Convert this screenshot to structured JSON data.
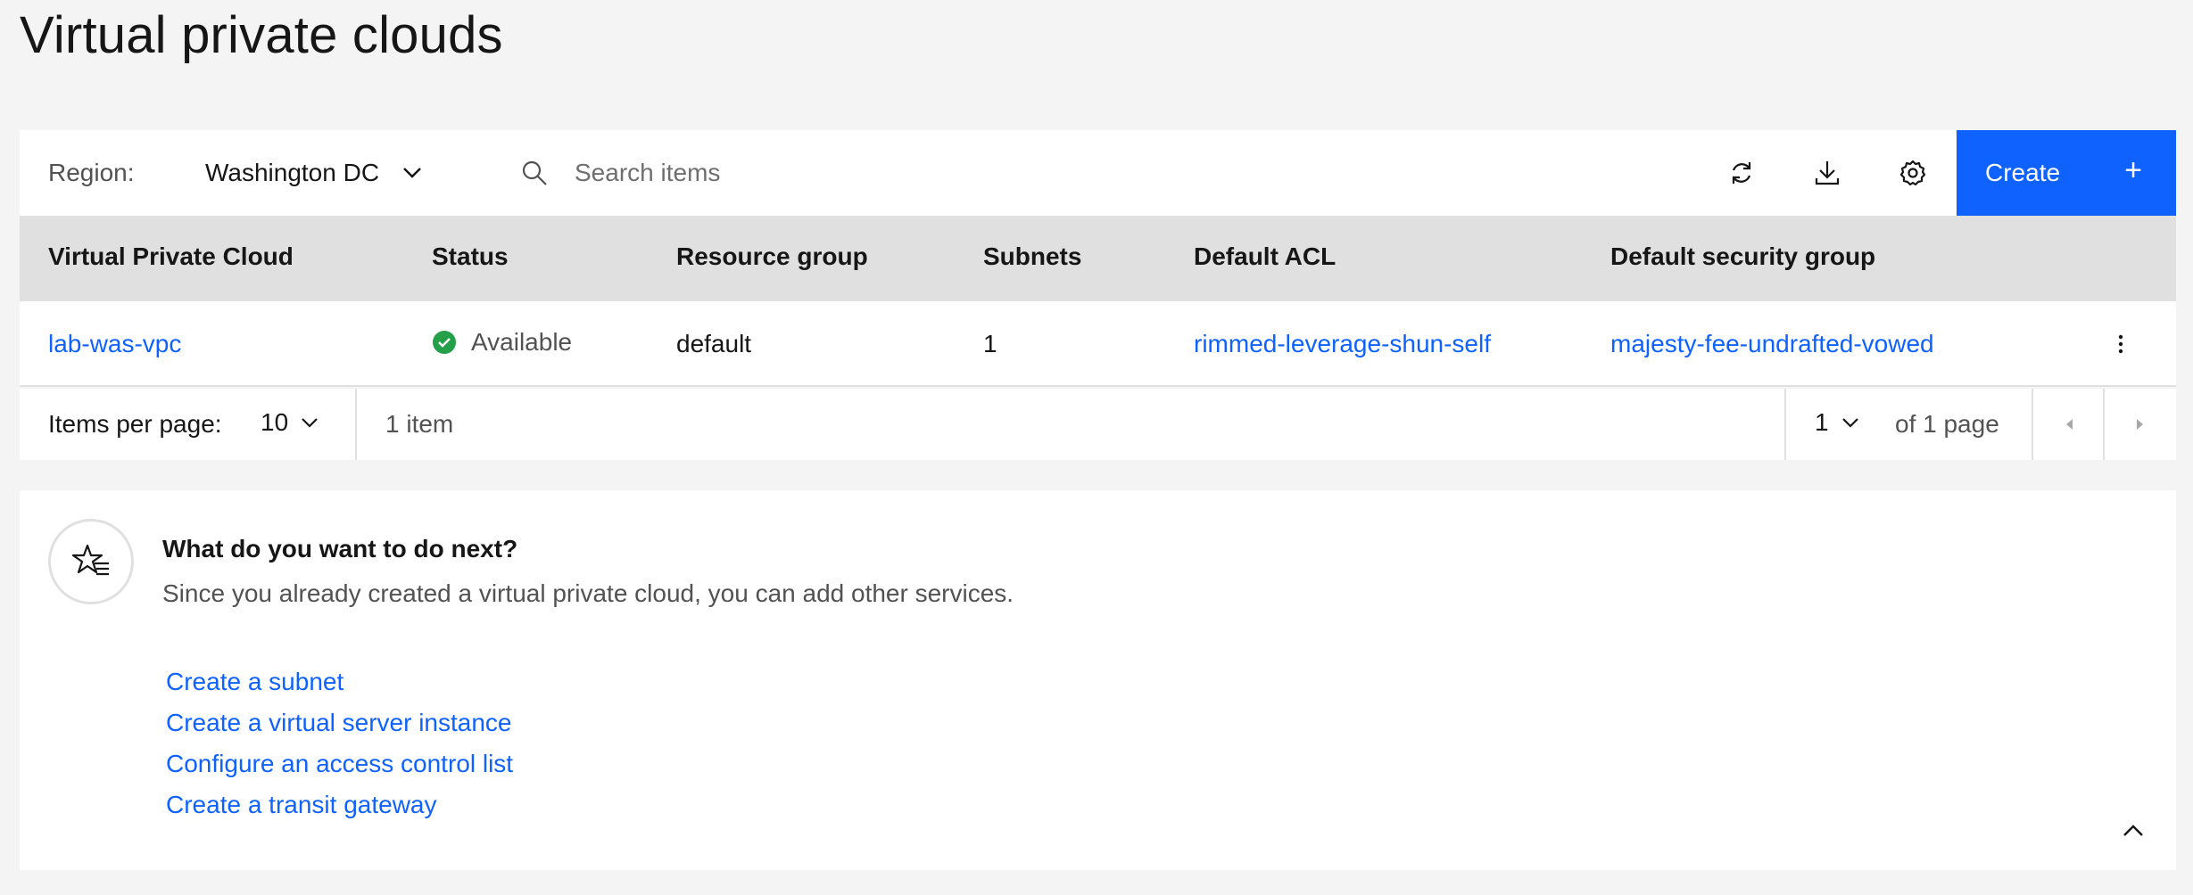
{
  "page": {
    "title": "Virtual private clouds"
  },
  "toolbar": {
    "region_label": "Region:",
    "region_value": "Washington DC",
    "search_placeholder": "Search items",
    "create_label": "Create",
    "create_icon": "+"
  },
  "table": {
    "headers": [
      "Virtual Private Cloud",
      "Status",
      "Resource group",
      "Subnets",
      "Default ACL",
      "Default security group"
    ],
    "rows": [
      {
        "name": "lab-was-vpc",
        "status": "Available",
        "resource_group": "default",
        "subnets": "1",
        "default_acl": "rimmed-leverage-shun-self",
        "default_security_group": "majesty-fee-undrafted-vowed"
      }
    ]
  },
  "pagination": {
    "items_per_page_label": "Items per page:",
    "items_per_page": "10",
    "item_count": "1 item",
    "current_page": "1",
    "of_pages": "of 1 page"
  },
  "next_steps": {
    "title": "What do you want to do next?",
    "description": "Since you already created a virtual private cloud, you can add other services.",
    "links": [
      "Create a subnet",
      "Create a virtual server instance",
      "Configure an access control list",
      "Create a transit gateway"
    ]
  },
  "colors": {
    "primary": "#0f62fe",
    "status_available": "#24a148",
    "background": "#f4f4f4"
  }
}
